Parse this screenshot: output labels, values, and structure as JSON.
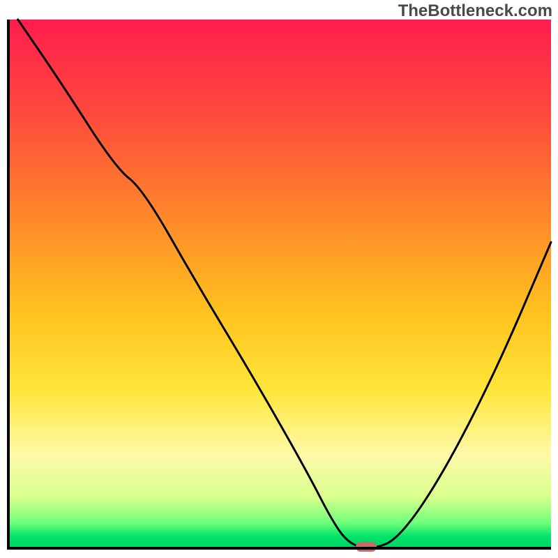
{
  "watermark": "TheBottleneck.com",
  "chart_data": {
    "type": "line",
    "title": "",
    "xlabel": "",
    "ylabel": "",
    "xlim": [
      0,
      100
    ],
    "ylim": [
      0,
      100
    ],
    "grid": false,
    "legend": false,
    "series": [
      {
        "name": "bottleneck-curve",
        "x": [
          2,
          10,
          20,
          25,
          35,
          45,
          55,
          60,
          63,
          67,
          72,
          80,
          90,
          100
        ],
        "y": [
          100,
          88,
          72,
          68,
          50,
          33,
          15,
          5,
          1,
          0,
          2,
          14,
          34,
          58
        ]
      }
    ],
    "marker": {
      "x": 66,
      "y": 0.5,
      "color": "#c76a6a"
    },
    "background_gradient": {
      "stops": [
        {
          "pos": 0,
          "color": "#ff1d4e"
        },
        {
          "pos": 0.18,
          "color": "#ff4a3c"
        },
        {
          "pos": 0.38,
          "color": "#ff8a2a"
        },
        {
          "pos": 0.55,
          "color": "#ffc21e"
        },
        {
          "pos": 0.7,
          "color": "#ffe63a"
        },
        {
          "pos": 0.82,
          "color": "#fff9a8"
        },
        {
          "pos": 0.9,
          "color": "#d9ff8e"
        },
        {
          "pos": 0.95,
          "color": "#6eff7a"
        },
        {
          "pos": 0.975,
          "color": "#00e36a"
        },
        {
          "pos": 1.0,
          "color": "#00d264"
        }
      ]
    }
  }
}
